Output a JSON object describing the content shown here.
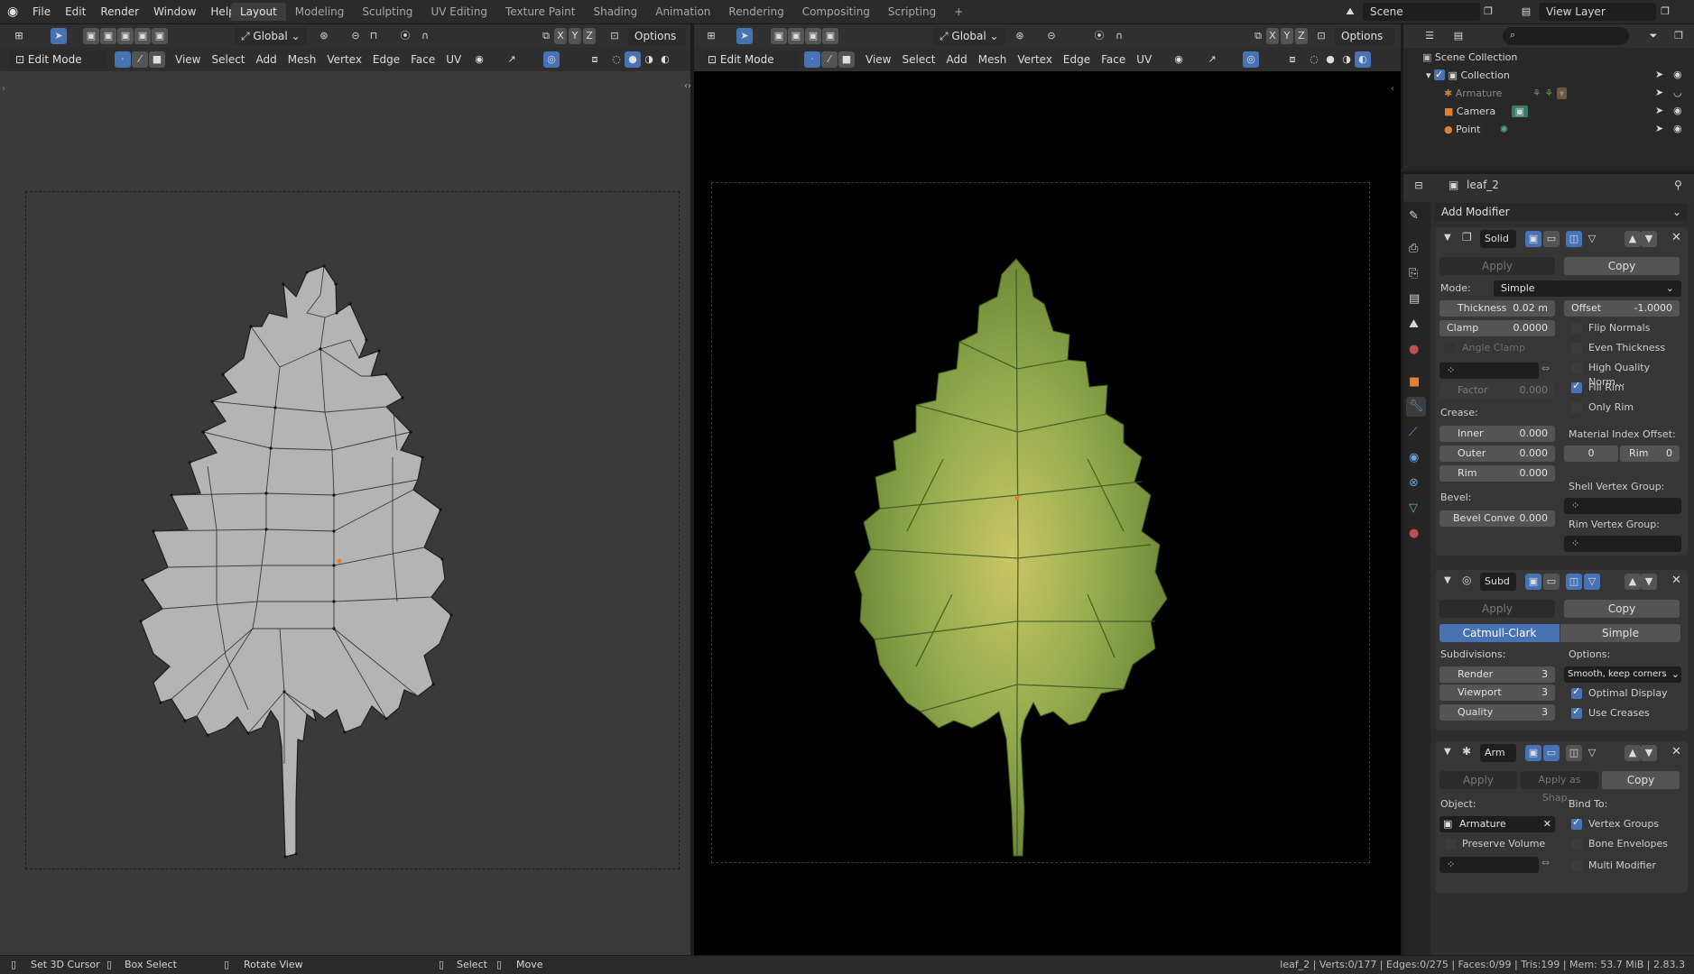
{
  "topbar": {
    "menus": [
      "File",
      "Edit",
      "Render",
      "Window",
      "Help"
    ],
    "workspaces": [
      "Layout",
      "Modeling",
      "Sculpting",
      "UV Editing",
      "Texture Paint",
      "Shading",
      "Animation",
      "Rendering",
      "Compositing",
      "Scripting"
    ],
    "active_workspace": "Layout",
    "add_workspace": "+",
    "scene_name": "Scene",
    "view_layer": "View Layer"
  },
  "viewport_left": {
    "transform_orientation": "Global",
    "options_label": "Options",
    "mode": "Edit Mode",
    "menus": [
      "View",
      "Select",
      "Add",
      "Mesh",
      "Vertex",
      "Edge",
      "Face",
      "UV"
    ],
    "axes": [
      "X",
      "Y",
      "Z"
    ]
  },
  "viewport_right": {
    "transform_orientation": "Global",
    "options_label": "Options",
    "mode": "Edit Mode",
    "menus": [
      "View",
      "Select",
      "Add",
      "Mesh",
      "Vertex",
      "Edge",
      "Face",
      "UV"
    ],
    "axes": [
      "X",
      "Y",
      "Z"
    ]
  },
  "outliner": {
    "root": "Scene Collection",
    "collection": "Collection",
    "items": [
      "Armature",
      "Camera",
      "Point"
    ]
  },
  "properties": {
    "object_name": "leaf_2",
    "add_modifier": "Add Modifier",
    "solidify": {
      "name": "Solid",
      "apply": "Apply",
      "copy": "Copy",
      "mode_label": "Mode:",
      "mode_value": "Simple",
      "thickness_label": "Thickness",
      "thickness_value": "0.02 m",
      "offset_label": "Offset",
      "offset_value": "-1.0000",
      "clamp_label": "Clamp",
      "clamp_value": "0.0000",
      "angle_clamp": "Angle Clamp",
      "flip_normals": "Flip Normals",
      "even_thickness": "Even Thickness",
      "hq_normals": "High Quality Norm...",
      "fill_rim": "Fill Rim",
      "only_rim": "Only Rim",
      "factor_label": "Factor",
      "factor_value": "0.000",
      "crease_label": "Crease:",
      "inner_label": "Inner",
      "inner_value": "0.000",
      "outer_label": "Outer",
      "outer_value": "0.000",
      "rim_label": "Rim",
      "rim_value": "0.000",
      "mat_offset_label": "Material Index Offset:",
      "mat_offset_value": "0",
      "mat_rim_label": "Rim",
      "mat_rim_value": "0",
      "shell_vg_label": "Shell Vertex Group:",
      "rim_vg_label": "Rim Vertex Group:",
      "bevel_label": "Bevel:",
      "bevel_convex_label": "Bevel Conve",
      "bevel_convex_value": "0.000"
    },
    "subsurf": {
      "name": "Subd",
      "apply": "Apply",
      "copy": "Copy",
      "catmull": "Catmull-Clark",
      "simple": "Simple",
      "subdivisions_label": "Subdivisions:",
      "options_label": "Options:",
      "render_label": "Render",
      "render_value": "3",
      "viewport_label": "Viewport",
      "viewport_value": "3",
      "quality_label": "Quality",
      "quality_value": "3",
      "uv_smooth": "Smooth, keep corners",
      "optimal_display": "Optimal Display",
      "use_creases": "Use Creases"
    },
    "armature": {
      "name": "Arm",
      "apply": "Apply",
      "apply_shape": "Apply as Shap...",
      "copy": "Copy",
      "object_label": "Object:",
      "object_value": "Armature",
      "bind_to_label": "Bind To:",
      "vertex_groups": "Vertex Groups",
      "preserve_volume": "Preserve Volume",
      "bone_envelopes": "Bone Envelopes",
      "multi_modifier": "Multi Modifier"
    }
  },
  "statusbar": {
    "hint1": "Set 3D Cursor",
    "hint2": "Box Select",
    "hint3": "Rotate View",
    "hint4": "Select",
    "hint5": "Move",
    "stats": "leaf_2 | Verts:0/177 | Edges:0/275 | Faces:0/99 | Tris:199 | Mem: 53.7 MiB | 2.83.3"
  },
  "colors": {
    "accent": "#4772b3",
    "leaf_green": "#8aa24a",
    "mesh_grey": "#b4b4b4"
  }
}
